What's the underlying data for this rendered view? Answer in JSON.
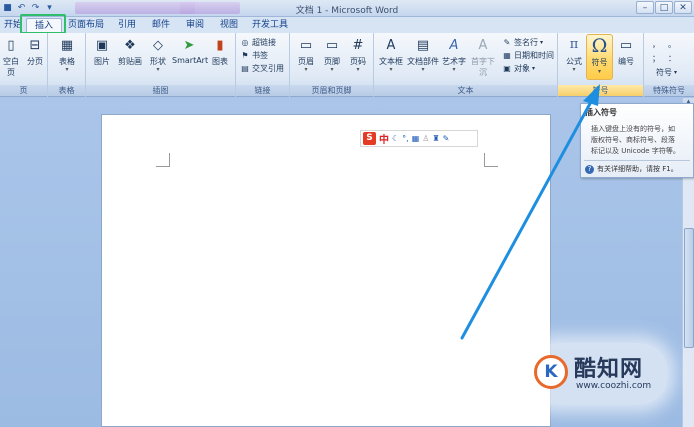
{
  "title": "文档 1 - Microsoft Word",
  "window_buttons": [
    "–",
    "□",
    "✕"
  ],
  "tabs": [
    "开始",
    "插入",
    "页面布局",
    "引用",
    "邮件",
    "审阅",
    "视图",
    "开发工具"
  ],
  "groups": {
    "pages": {
      "label": "页",
      "buttons": [
        "空白页",
        "分页"
      ]
    },
    "tables": {
      "label": "表格",
      "buttons": [
        "表格"
      ]
    },
    "illustrations": {
      "label": "插图",
      "buttons": [
        "图片",
        "剪贴画",
        "形状",
        "SmartArt",
        "图表"
      ]
    },
    "links": {
      "label": "链接",
      "buttons": [
        "超链接",
        "书签",
        "交叉引用"
      ]
    },
    "header_footer": {
      "label": "页眉和页脚",
      "buttons": [
        "页眉",
        "页脚",
        "页码"
      ]
    },
    "text": {
      "label": "文本",
      "buttons": [
        "文本框",
        "文档部件",
        "艺术字",
        "首字下沉"
      ],
      "small": [
        "签名行",
        "日期和时间",
        "对象"
      ]
    },
    "symbols": {
      "label": "符号",
      "buttons": [
        "公式",
        "符号",
        "编号"
      ]
    },
    "special": {
      "label": "特殊符号",
      "buttons": [
        "符号"
      ],
      "dots": [
        "，",
        "。",
        "；",
        "："
      ]
    }
  },
  "ime": {
    "logo": "S",
    "lang": "中"
  },
  "tooltip": {
    "title": "插入符号",
    "body": [
      "插入键盘上没有的符号，如",
      "版权符号、商标符号、段落",
      "标记以及 Unicode 字符等。"
    ],
    "help": "有关详细帮助，请按 F1。"
  },
  "watermark": {
    "name": "酷知网",
    "url": "www.coozhi.com",
    "logo": "K"
  },
  "colors": {
    "highlight": "#2fbe6c",
    "arrow": "#1e8fe0"
  }
}
